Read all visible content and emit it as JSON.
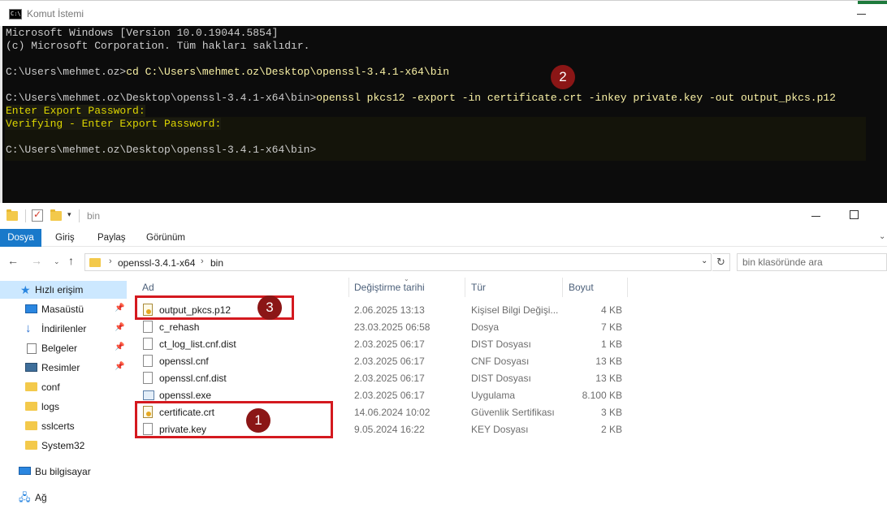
{
  "cmd": {
    "title": "Komut İstemi",
    "icon_text": "C:\\.",
    "lines": {
      "l1": "Microsoft Windows [Version 10.0.19044.5854]",
      "l2": "(c) Microsoft Corporation. Tüm hakları saklıdır.",
      "l3_prompt": "C:\\Users\\mehmet.oz>",
      "l3_cmd": "cd C:\\Users\\mehmet.oz\\Desktop\\openssl-3.4.1-x64\\bin",
      "l4_prompt": "C:\\Users\\mehmet.oz\\Desktop\\openssl-3.4.1-x64\\bin>",
      "l4_cmd": "openssl pkcs12 -export -in certificate.crt -inkey private.key -out output_pkcs.p12",
      "l5": "Enter Export Password:",
      "l6": "Verifying - Enter Export Password:",
      "l7": "C:\\Users\\mehmet.oz\\Desktop\\openssl-3.4.1-x64\\bin>"
    }
  },
  "explorer": {
    "title": "bin",
    "ribbon": {
      "dosya": "Dosya",
      "giris": "Giriş",
      "paylas": "Paylaş",
      "gorunum": "Görünüm"
    },
    "nav_buttons": {
      "back": "←",
      "forward": "→",
      "recent": "⌄",
      "up": "↑"
    },
    "address": {
      "crumb1": "openssl-3.4.1-x64",
      "crumb2": "bin",
      "chevron": "›"
    },
    "search_placeholder": "bin klasöründe ara",
    "nav_pane": [
      {
        "label": "Hızlı erişim",
        "pinned": false
      },
      {
        "label": "Masaüstü",
        "pinned": true
      },
      {
        "label": "İndirilenler",
        "pinned": true
      },
      {
        "label": "Belgeler",
        "pinned": true
      },
      {
        "label": "Resimler",
        "pinned": true
      },
      {
        "label": "conf",
        "pinned": false
      },
      {
        "label": "logs",
        "pinned": false
      },
      {
        "label": "sslcerts",
        "pinned": false
      },
      {
        "label": "System32",
        "pinned": false
      },
      {
        "label": "Bu bilgisayar",
        "pinned": false
      },
      {
        "label": "Ağ",
        "pinned": false
      }
    ],
    "columns": {
      "name": "Ad",
      "date": "Değiştirme tarihi",
      "type": "Tür",
      "size": "Boyut"
    },
    "files": [
      {
        "name": "output_pkcs.p12",
        "date": "2.06.2025 13:13",
        "type": "Kişisel Bilgi Değişi...",
        "size": "4 KB",
        "icon": "cert"
      },
      {
        "name": "c_rehash",
        "date": "23.03.2025 06:58",
        "type": "Dosya",
        "size": "7 KB",
        "icon": "file"
      },
      {
        "name": "ct_log_list.cnf.dist",
        "date": "2.03.2025 06:17",
        "type": "DIST Dosyası",
        "size": "1 KB",
        "icon": "file"
      },
      {
        "name": "openssl.cnf",
        "date": "2.03.2025 06:17",
        "type": "CNF Dosyası",
        "size": "13 KB",
        "icon": "file"
      },
      {
        "name": "openssl.cnf.dist",
        "date": "2.03.2025 06:17",
        "type": "DIST Dosyası",
        "size": "13 KB",
        "icon": "file"
      },
      {
        "name": "openssl.exe",
        "date": "2.03.2025 06:17",
        "type": "Uygulama",
        "size": "8.100 KB",
        "icon": "exe"
      },
      {
        "name": "certificate.crt",
        "date": "14.06.2024 10:02",
        "type": "Güvenlik Sertifikası",
        "size": "3 KB",
        "icon": "cert"
      },
      {
        "name": "private.key",
        "date": "9.05.2024 16:22",
        "type": "KEY Dosyası",
        "size": "2 KB",
        "icon": "file"
      }
    ]
  },
  "annotations": {
    "badge1": "1",
    "badge2": "2",
    "badge3": "3"
  },
  "colors": {
    "annotation_red": "#d4191f",
    "badge_red": "#8b1616",
    "ribbon_blue": "#1979ca",
    "console_bg": "#0c0c0c",
    "console_yellow": "#f9f1a5"
  }
}
